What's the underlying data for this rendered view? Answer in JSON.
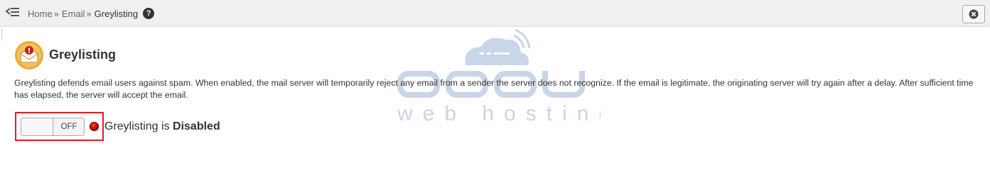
{
  "breadcrumb": {
    "items": [
      "Home",
      "Email"
    ],
    "separator": "»",
    "current": "Greylisting",
    "help_icon": "help-circle-icon"
  },
  "topbar": {
    "menu_icon": "hamburger-collapse-icon",
    "close_icon": "close-circle-icon"
  },
  "page": {
    "icon": "email-warning-icon",
    "title": "Greylisting",
    "description": "Greylisting defends email users against spam. When enabled, the mail server will temporarily reject any email from a sender the server does not recognize. If the email is legitimate, the originating server will try again after a delay. After sufficient time has elapsed, the server will accept the email."
  },
  "toggle": {
    "label": "OFF",
    "state": "off"
  },
  "status": {
    "indicator_color": "#d40000",
    "prefix": "Greylisting is",
    "value": "Disabled"
  },
  "watermark": {
    "brand": "accu",
    "tagline": "web hosting",
    "color": "#c9d5e8"
  },
  "colors": {
    "highlight": "#e11d21",
    "topbar_bg": "#f0f0f0",
    "icon_orange": "#f0a830"
  }
}
